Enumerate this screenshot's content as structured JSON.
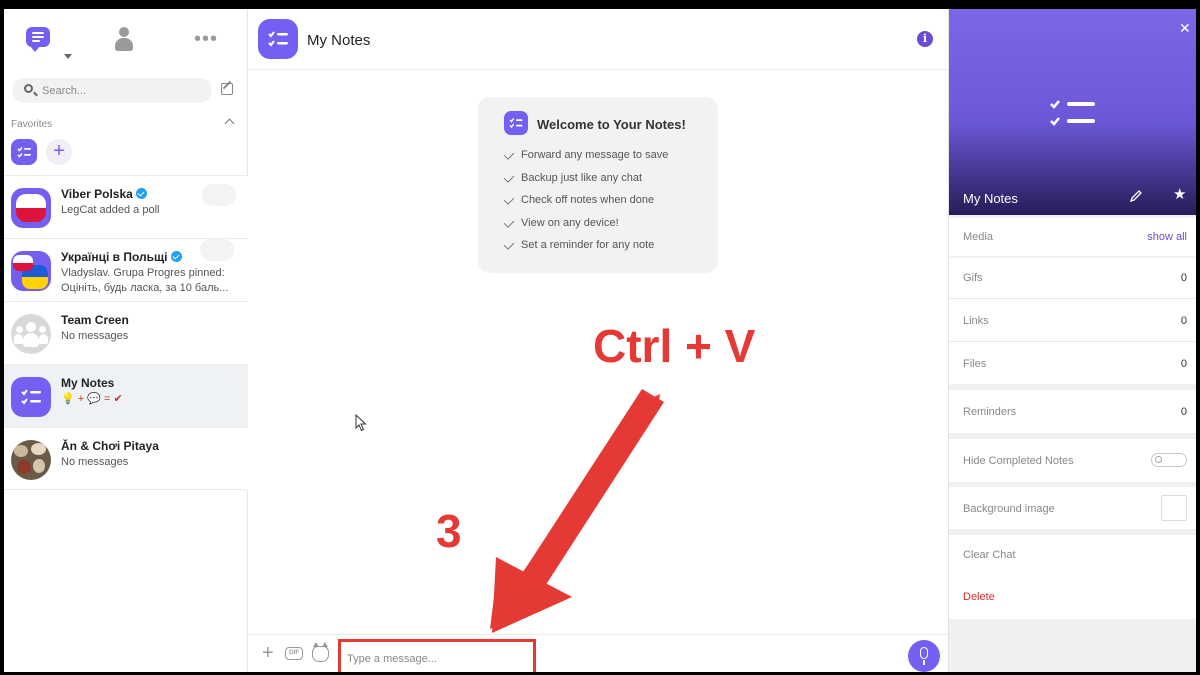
{
  "sidebar": {
    "search_placeholder": "Search...",
    "favorites_label": "Favorites",
    "chats": [
      {
        "name": "Viber Polska",
        "verified": true,
        "preview": "LegCat added a poll",
        "avatar": "poland-flag"
      },
      {
        "name": "Українці в Польщі",
        "verified": true,
        "preview": "Vladyslav. Grupa Progres pinned:",
        "preview2": "Оцініть, будь ласка, за 10 баль...",
        "avatar": "ukraine-poland-flags"
      },
      {
        "name": "Team Creen",
        "verified": false,
        "preview": "No messages",
        "avatar": "group"
      },
      {
        "name": "My Notes",
        "verified": false,
        "preview": "💡 + 💬 = ✔",
        "avatar": "notes",
        "active": true
      },
      {
        "name": "Ăn & Chơi Pitaya",
        "verified": false,
        "preview": "No messages",
        "avatar": "food-photo"
      }
    ]
  },
  "chat": {
    "title": "My Notes",
    "welcome_title": "Welcome to Your Notes!",
    "welcome_items": [
      "Forward any message to save",
      "Backup just like any chat",
      "Check off notes when done",
      "View on any device!",
      "Set a reminder for any note"
    ],
    "composer_placeholder": "Type a message...",
    "gif_label": "GIF"
  },
  "annotation": {
    "shortcut": "Ctrl + V",
    "step": "3",
    "color": "#e53935"
  },
  "info_panel": {
    "name": "My Notes",
    "media_label": "Media",
    "show_all": "show all",
    "rows": [
      {
        "label": "Gifs",
        "value": "0"
      },
      {
        "label": "Links",
        "value": "0"
      },
      {
        "label": "Files",
        "value": "0"
      },
      {
        "label": "Reminders",
        "value": "0"
      }
    ],
    "hide_completed_label": "Hide Completed Notes",
    "hide_completed_on": false,
    "background_label": "Background image",
    "clear_chat": "Clear Chat",
    "delete": "Delete"
  },
  "colors": {
    "accent": "#7360f2",
    "delete": "#d32f2f"
  }
}
